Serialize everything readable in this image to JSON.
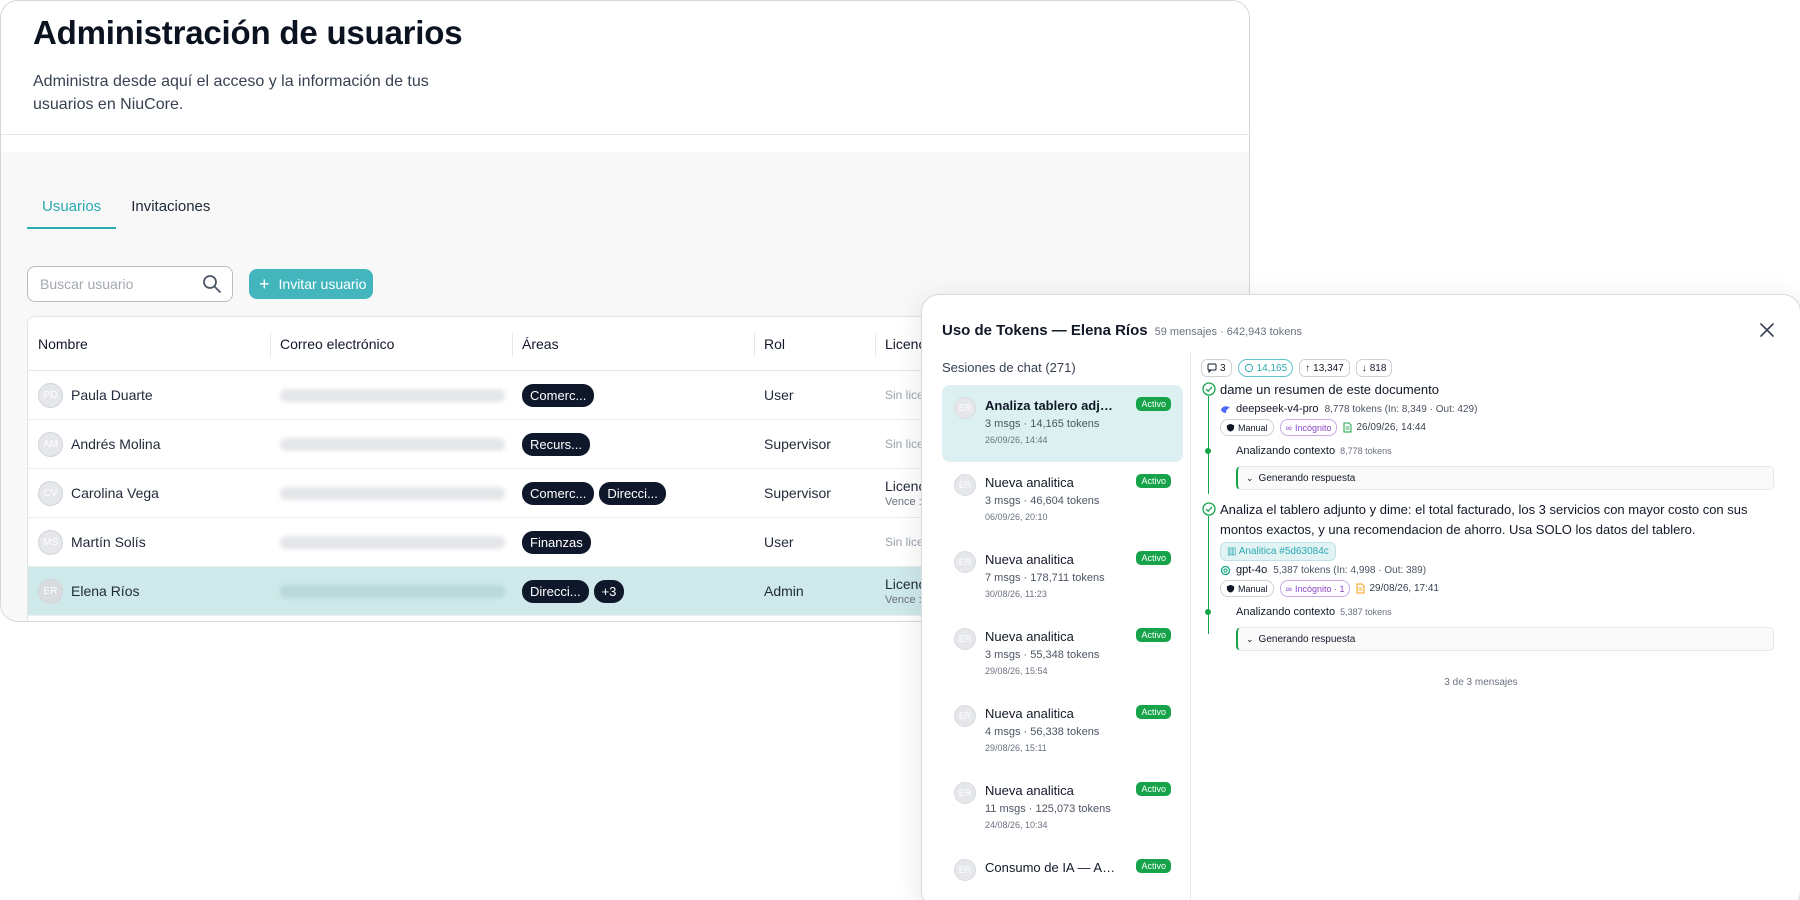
{
  "page": {
    "title": "Administración de usuarios",
    "subtitle": "Administra desde aquí el acceso y la información de tus usuarios en NiuCore."
  },
  "tabs": [
    {
      "label": "Usuarios",
      "active": true
    },
    {
      "label": "Invitaciones",
      "active": false
    }
  ],
  "search": {
    "placeholder": "Buscar usuario",
    "icon": "search-icon"
  },
  "invite_button": {
    "label": "Invitar usuario",
    "icon": "plus-icon"
  },
  "table": {
    "headers": [
      "Nombre",
      "Correo electrónico",
      "Áreas",
      "Rol",
      "Licenc"
    ],
    "rows": [
      {
        "initials": "PD",
        "name": "Paula Duarte",
        "areas": [
          "Comerc..."
        ],
        "role": "User",
        "license": "Sin lice",
        "license_sub": ""
      },
      {
        "initials": "AM",
        "name": "Andrés Molina",
        "areas": [
          "Recurs..."
        ],
        "role": "Supervisor",
        "license": "Sin lice",
        "license_sub": ""
      },
      {
        "initials": "CV",
        "name": "Carolina Vega",
        "areas": [
          "Comerc...",
          "Direcci..."
        ],
        "role": "Supervisor",
        "license": "Licenc",
        "license_sub": "Vence :"
      },
      {
        "initials": "MS",
        "name": "Martín Solís",
        "areas": [
          "Finanzas"
        ],
        "role": "User",
        "license": "Sin lice",
        "license_sub": ""
      },
      {
        "initials": "ER",
        "name": "Elena Ríos",
        "areas": [
          "Direcci...",
          "+3"
        ],
        "role": "Admin",
        "license": "Licenc",
        "license_sub": "Vence :",
        "selected": true
      }
    ]
  },
  "modal": {
    "title": "Uso de Tokens — Elena Ríos",
    "meta": "59 mensajes · 642,943 tokens",
    "sessions_heading": "Sesiones de chat (271)",
    "sessions": [
      {
        "initials": "ER",
        "title": "Analiza tablero adjunto",
        "meta": "3 msgs · 14,165 tokens",
        "date": "26/09/26, 14:44",
        "badge": "Activo",
        "active": true
      },
      {
        "initials": "ER",
        "title": "Nueva analitica",
        "meta": "3 msgs · 46,604 tokens",
        "date": "06/09/26, 20:10",
        "badge": "Activo"
      },
      {
        "initials": "ER",
        "title": "Nueva analitica",
        "meta": "7 msgs · 178,711 tokens",
        "date": "30/08/26, 11:23",
        "badge": "Activo"
      },
      {
        "initials": "ER",
        "title": "Nueva analitica",
        "meta": "3 msgs · 55,348 tokens",
        "date": "29/08/26, 15:54",
        "badge": "Activo"
      },
      {
        "initials": "ER",
        "title": "Nueva analitica",
        "meta": "4 msgs · 56,338 tokens",
        "date": "29/08/26, 15:11",
        "badge": "Activo"
      },
      {
        "initials": "ER",
        "title": "Nueva analitica",
        "meta": "11 msgs · 125,073 tokens",
        "date": "24/08/26, 10:34",
        "badge": "Activo"
      },
      {
        "initials": "ER",
        "title": "Consumo de IA — Agosto...",
        "meta": "",
        "date": "",
        "badge": "Activo"
      }
    ],
    "stats": {
      "messages": "3",
      "total": "14,165",
      "input": "13,347",
      "output": "818"
    },
    "messages": [
      {
        "text": "dame un resumen de este documento",
        "attachment": "",
        "model": "deepseek-v4-pro",
        "tokens": "8,778 tokens (In: 8,349 · Out: 429)",
        "mode": "Manual",
        "incognito": "Incógnito",
        "date": "26/09/26, 14:44",
        "step_label": "Analizando contexto",
        "step_tokens": "8,778 tokens",
        "generating": "Generando respuesta"
      },
      {
        "text": "Analiza el tablero adjunto y dime: el total facturado, los 3 servicios con mayor costo con sus montos exactos, y una recomendacion de ahorro. Usa SOLO los datos del tablero.",
        "attachment": "Analitica #5d63084c",
        "model": "gpt-4o",
        "tokens": "5,387 tokens (In: 4,998 · Out: 389)",
        "mode": "Manual",
        "incognito": "Incógnito · 1",
        "date": "29/08/26, 17:41",
        "step_label": "Analizando contexto",
        "step_tokens": "5,387 tokens",
        "generating": "Generando respuesta"
      }
    ],
    "count_footer": "3 de 3 mensajes"
  },
  "colors": {
    "accent": "#2aaab1",
    "accent_button": "#43b6bd",
    "selected_row": "#cfe9ea",
    "active_badge": "#16a34a",
    "chip": "#0f172a"
  }
}
